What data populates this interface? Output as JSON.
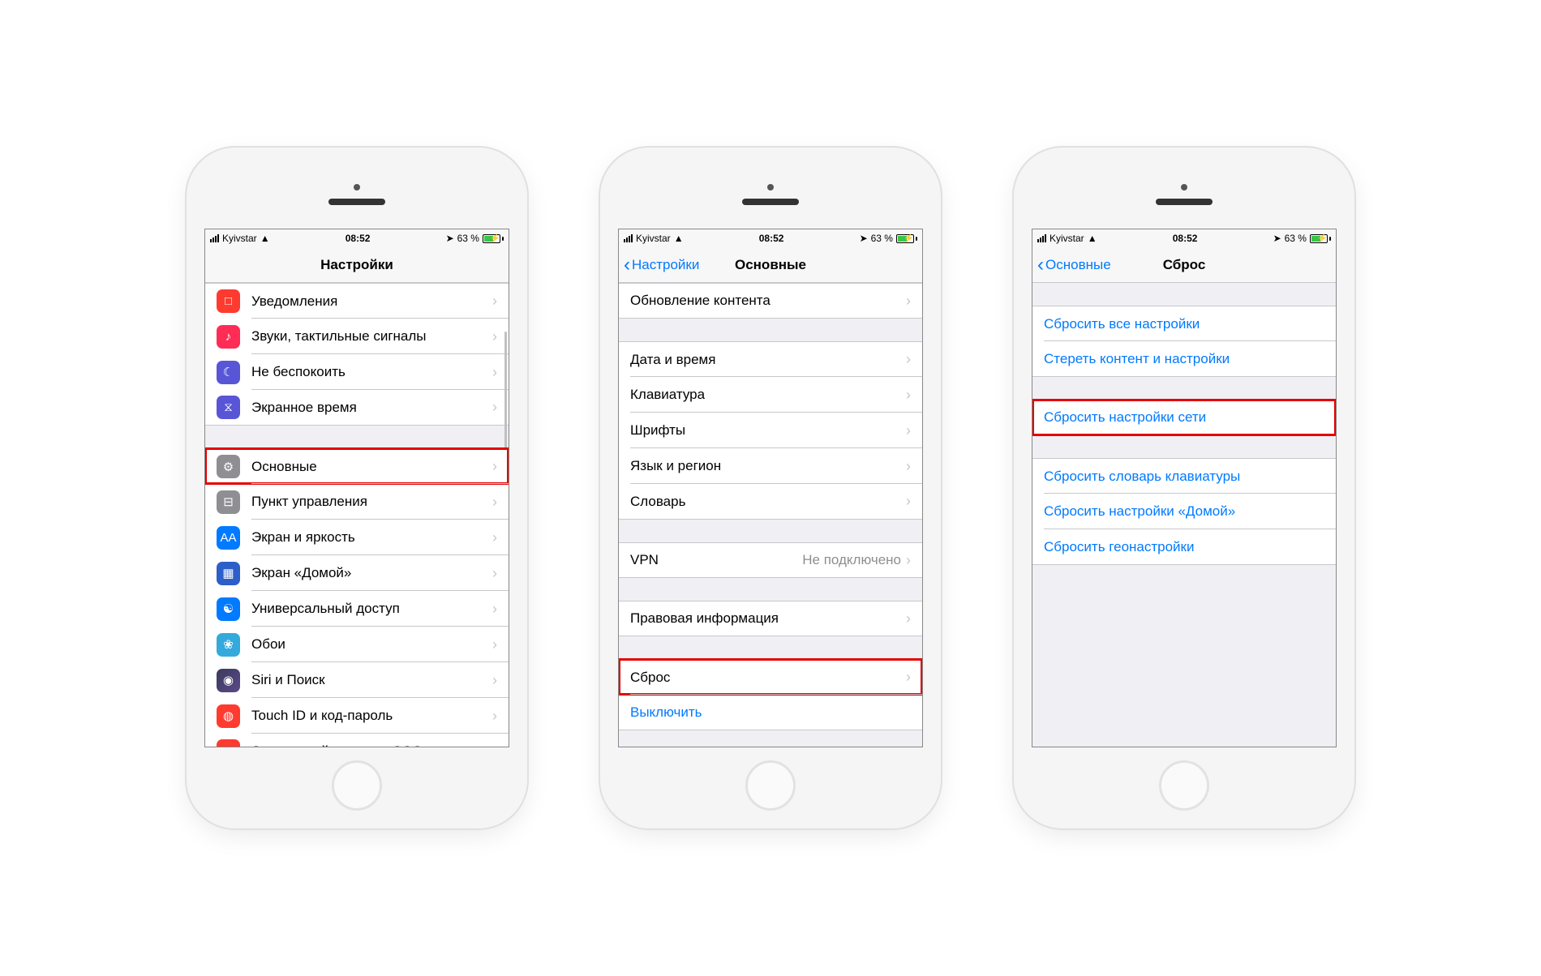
{
  "status": {
    "carrier": "Kyivstar",
    "time": "08:52",
    "battery_pct": "63 %"
  },
  "phone1": {
    "title": "Настройки",
    "g1": [
      {
        "label": "Уведомления",
        "icon": "□",
        "iconcls": "ic-red"
      },
      {
        "label": "Звуки, тактильные сигналы",
        "icon": "♪",
        "iconcls": "ic-pink"
      },
      {
        "label": "Не беспокоить",
        "icon": "☾",
        "iconcls": "ic-purple"
      },
      {
        "label": "Экранное время",
        "icon": "⧖",
        "iconcls": "ic-hourglass"
      }
    ],
    "g2": [
      {
        "label": "Основные",
        "icon": "⚙",
        "iconcls": "ic-grey",
        "hl": true
      },
      {
        "label": "Пункт управления",
        "icon": "⊟",
        "iconcls": "ic-grey"
      },
      {
        "label": "Экран и яркость",
        "icon": "AA",
        "iconcls": "ic-blue"
      },
      {
        "label": "Экран «Домой»",
        "icon": "▦",
        "iconcls": "ic-darkblue"
      },
      {
        "label": "Универсальный доступ",
        "icon": "☯",
        "iconcls": "ic-blue"
      },
      {
        "label": "Обои",
        "icon": "❀",
        "iconcls": "ic-cyan"
      },
      {
        "label": "Siri и Поиск",
        "icon": "◉",
        "iconcls": "ic-siri"
      },
      {
        "label": "Touch ID и код-пароль",
        "icon": "◍",
        "iconcls": "ic-orange"
      },
      {
        "label": "Экстренный вызов — SOS",
        "icon": "SOS",
        "iconcls": "ic-red"
      }
    ]
  },
  "phone2": {
    "back": "Настройки",
    "title": "Основные",
    "g0": [
      {
        "label": "Обновление контента"
      }
    ],
    "g1": [
      {
        "label": "Дата и время"
      },
      {
        "label": "Клавиатура"
      },
      {
        "label": "Шрифты"
      },
      {
        "label": "Язык и регион"
      },
      {
        "label": "Словарь"
      }
    ],
    "g2": [
      {
        "label": "VPN",
        "value": "Не подключено"
      }
    ],
    "g3": [
      {
        "label": "Правовая информация"
      }
    ],
    "g4": [
      {
        "label": "Сброс",
        "hl": true
      },
      {
        "label": "Выключить",
        "link": true,
        "nochev": true
      }
    ]
  },
  "phone3": {
    "back": "Основные",
    "title": "Сброс",
    "g1": [
      {
        "label": "Сбросить все настройки"
      },
      {
        "label": "Стереть контент и настройки"
      }
    ],
    "g2": [
      {
        "label": "Сбросить настройки сети",
        "hl": true
      }
    ],
    "g3": [
      {
        "label": "Сбросить словарь клавиатуры"
      },
      {
        "label": "Сбросить настройки «Домой»"
      },
      {
        "label": "Сбросить геонастройки"
      }
    ]
  }
}
